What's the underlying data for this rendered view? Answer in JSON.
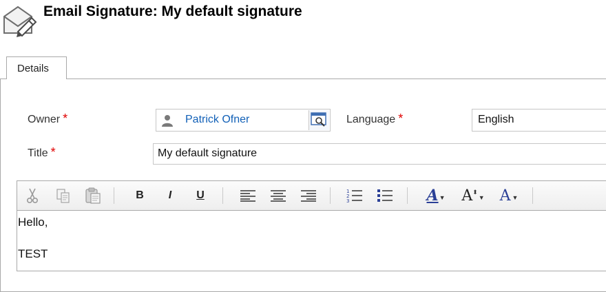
{
  "header": {
    "title": "Email Signature: My default signature",
    "icon": "envelope-pencil-icon"
  },
  "tabs": [
    {
      "label": "Details",
      "active": true
    }
  ],
  "form": {
    "owner": {
      "label": "Owner",
      "required_mark": "*",
      "value": "Patrick Ofner",
      "icon": "user-icon",
      "lookup_icon": "lookup-icon"
    },
    "language": {
      "label": "Language",
      "required_mark": "*",
      "value": "English"
    },
    "title": {
      "label": "Title",
      "required_mark": "*",
      "value": "My default signature"
    }
  },
  "editor": {
    "toolbar": {
      "cut": "cut-icon",
      "copy": "copy-icon",
      "paste": "paste-icon",
      "bold": "B",
      "italic": "I",
      "underline": "U",
      "align_left": "align-left-icon",
      "align_center": "align-center-icon",
      "align_right": "align-right-icon",
      "numbered_list": "numbered-list-icon",
      "bulleted_list": "bulleted-list-icon",
      "font": "A",
      "font_size": "A",
      "font_color": "A",
      "accent_color": "#2a3f96"
    },
    "content": {
      "line1": "Hello,",
      "line2": "TEST"
    }
  },
  "colors": {
    "link": "#1160b7",
    "required": "#e00000",
    "border": "#a8a8a8"
  }
}
